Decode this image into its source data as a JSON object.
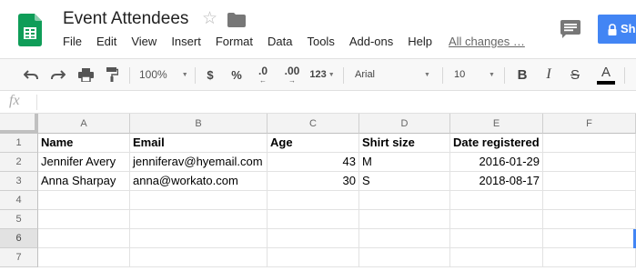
{
  "header": {
    "title": "Event Attendees",
    "menu": [
      "File",
      "Edit",
      "View",
      "Insert",
      "Format",
      "Data",
      "Tools",
      "Add-ons",
      "Help"
    ],
    "changes": "All changes …",
    "share_label": "Sh",
    "colors": {
      "sheets_green": "#0f9d58",
      "share_blue": "#4285f4"
    }
  },
  "toolbar": {
    "zoom": "100%",
    "currency": "$",
    "percent": "%",
    "dec_less": ".0",
    "dec_more": ".00",
    "more_formats": "123",
    "font": "Arial",
    "font_size": "10",
    "bold": "B",
    "italic": "I",
    "strike": "S",
    "font_color": "A"
  },
  "formula_bar": {
    "fx": "fx",
    "value": ""
  },
  "sheet": {
    "columns": [
      "A",
      "B",
      "C",
      "D",
      "E",
      "F"
    ],
    "row_numbers": [
      "1",
      "2",
      "3",
      "4",
      "5",
      "6",
      "7"
    ],
    "selected_row": "6",
    "rows": [
      [
        "Name",
        "Email",
        "Age",
        "Shirt size",
        "Date registered",
        ""
      ],
      [
        "Jennifer Avery",
        "jenniferav@hyemail.com",
        "43",
        "M",
        "2016-01-29",
        ""
      ],
      [
        "Anna Sharpay",
        "anna@workato.com",
        "30",
        "S",
        "2018-08-17",
        ""
      ],
      [
        "",
        "",
        "",
        "",
        "",
        ""
      ],
      [
        "",
        "",
        "",
        "",
        "",
        ""
      ],
      [
        "",
        "",
        "",
        "",
        "",
        ""
      ],
      [
        "",
        "",
        "",
        "",
        "",
        ""
      ]
    ]
  }
}
